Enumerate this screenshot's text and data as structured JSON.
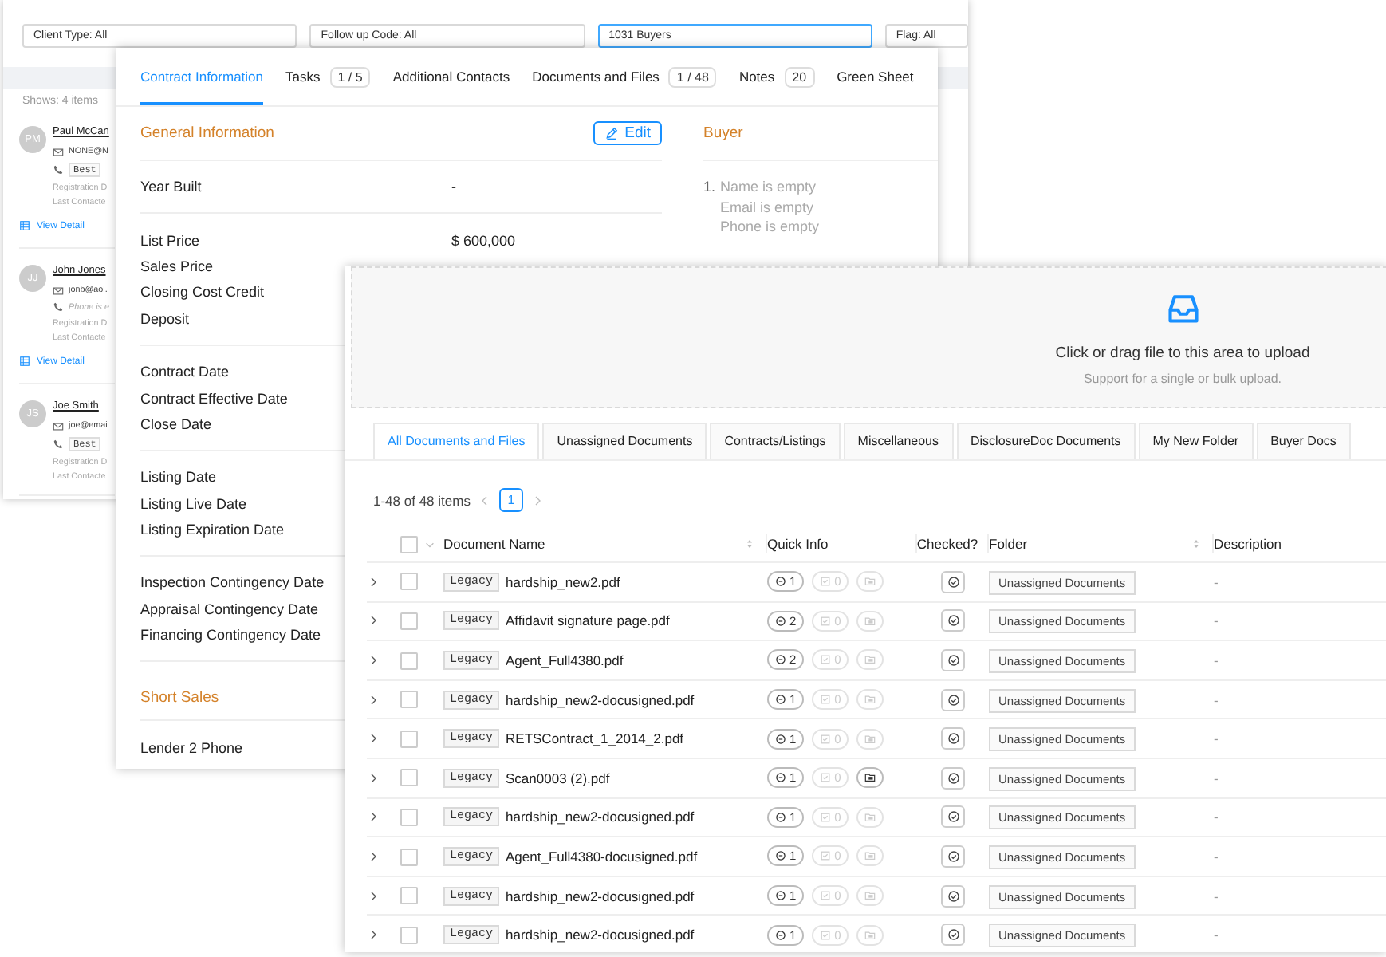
{
  "back_window": {
    "filters": [
      {
        "label": "Client Type: All",
        "focused": false
      },
      {
        "label": "Follow up Code: All",
        "focused": false
      },
      {
        "label": "1031 Buyers",
        "focused": true
      },
      {
        "label": "Flag: All",
        "focused": false
      }
    ],
    "summary": "Shows: 4 items",
    "contacts": [
      {
        "initials": "PM",
        "name": "Paul McCan",
        "email": "NONE@N",
        "phone": {
          "kind": "tagged",
          "tag": "Best"
        },
        "registration": "Registration D",
        "last_contact": "Last Contacte",
        "link": "View Detail"
      },
      {
        "initials": "JJ",
        "name": "John Jones",
        "email": "jonb@aol.",
        "phone": {
          "kind": "empty",
          "text": "Phone is e"
        },
        "registration": "Registration D",
        "last_contact": "Last Contacte",
        "link": "View Detail"
      },
      {
        "initials": "JS",
        "name": "Joe Smith",
        "email": "joe@emai",
        "phone": {
          "kind": "tagged",
          "tag": "Best"
        },
        "registration": "Registration D",
        "last_contact": "Last Contacte"
      }
    ]
  },
  "contract_window": {
    "tabs": [
      {
        "label": "Contract Information",
        "selected": true
      },
      {
        "label": "Tasks",
        "count": "1 / 5",
        "selected": false
      },
      {
        "label": "Additional Contacts",
        "selected": false
      },
      {
        "label": "Documents and Files",
        "count": "1 / 48",
        "selected": false
      },
      {
        "label": "Notes",
        "count": "20",
        "selected": false
      },
      {
        "label": "Green Sheet",
        "selected": false
      }
    ],
    "general": {
      "title": "General Information",
      "edit_label": "Edit",
      "groups": [
        [
          {
            "label": "Year Built",
            "value": "-"
          }
        ],
        [
          {
            "label": "List Price",
            "value": "$ 600,000"
          },
          {
            "label": "Sales Price"
          },
          {
            "label": "Closing Cost Credit"
          },
          {
            "label": "Deposit"
          }
        ],
        [
          {
            "label": "Contract Date"
          },
          {
            "label": "Contract Effective Date"
          },
          {
            "label": "Close Date"
          }
        ],
        [
          {
            "label": "Listing Date"
          },
          {
            "label": "Listing Live Date"
          },
          {
            "label": "Listing Expiration Date"
          }
        ],
        [
          {
            "label": "Inspection Contingency Date"
          },
          {
            "label": "Appraisal Contingency Date"
          },
          {
            "label": "Financing Contingency Date"
          }
        ]
      ]
    },
    "short_sales": {
      "title": "Short Sales",
      "fields": [
        {
          "label": "Lender 2 Phone"
        }
      ]
    },
    "buyer": {
      "title": "Buyer",
      "entries": [
        {
          "number": "1.",
          "lines": [
            "Name is empty",
            "Email is empty",
            "Phone is empty"
          ]
        }
      ]
    }
  },
  "documents_window": {
    "upload": {
      "text": "Click or drag file to this area to upload",
      "hint": "Support for a single or bulk upload."
    },
    "tabs": [
      {
        "label": "All Documents and Files",
        "selected": true
      },
      {
        "label": "Unassigned Documents",
        "selected": false
      },
      {
        "label": "Contracts/Listings",
        "selected": false
      },
      {
        "label": "Miscellaneous",
        "selected": false
      },
      {
        "label": "DisclosureDoc Documents",
        "selected": false
      },
      {
        "label": "My New Folder",
        "selected": false
      },
      {
        "label": "Buyer Docs",
        "selected": false
      }
    ],
    "pagination": {
      "summary": "1-48 of 48 items",
      "pages": [
        {
          "label": "1",
          "selected": true
        }
      ]
    },
    "table": {
      "all_selected": false,
      "columns": [
        {
          "label": "Document Name",
          "sortable": true
        },
        {
          "label": "Quick Info",
          "sortable": false
        },
        {
          "label": "Checked?",
          "sortable": false
        },
        {
          "label": "Folder",
          "sortable": true
        },
        {
          "label": "Description",
          "sortable": false
        }
      ],
      "rows": [
        {
          "selected": false,
          "tag": "Legacy",
          "name": "hardship_new2.pdf",
          "comments": "1",
          "tasks": "0",
          "folder_linked": false,
          "folder": "Unassigned Documents",
          "description": "-"
        },
        {
          "selected": false,
          "tag": "Legacy",
          "name": "Affidavit signature page.pdf",
          "comments": "2",
          "tasks": "0",
          "folder_linked": false,
          "folder": "Unassigned Documents",
          "description": "-"
        },
        {
          "selected": false,
          "tag": "Legacy",
          "name": "Agent_Full4380.pdf",
          "comments": "2",
          "tasks": "0",
          "folder_linked": false,
          "folder": "Unassigned Documents",
          "description": "-"
        },
        {
          "selected": false,
          "tag": "Legacy",
          "name": "hardship_new2-docusigned.pdf",
          "comments": "1",
          "tasks": "0",
          "folder_linked": false,
          "folder": "Unassigned Documents",
          "description": "-"
        },
        {
          "selected": false,
          "tag": "Legacy",
          "name": "RETSContract_1_2014_2.pdf",
          "comments": "1",
          "tasks": "0",
          "folder_linked": false,
          "folder": "Unassigned Documents",
          "description": "-"
        },
        {
          "selected": false,
          "tag": "Legacy",
          "name": "Scan0003 (2).pdf",
          "comments": "1",
          "tasks": "0",
          "folder_linked": true,
          "folder": "Unassigned Documents",
          "description": "-"
        },
        {
          "selected": false,
          "tag": "Legacy",
          "name": "hardship_new2-docusigned.pdf",
          "comments": "1",
          "tasks": "0",
          "folder_linked": false,
          "folder": "Unassigned Documents",
          "description": "-"
        },
        {
          "selected": false,
          "tag": "Legacy",
          "name": "Agent_Full4380-docusigned.pdf",
          "comments": "1",
          "tasks": "0",
          "folder_linked": false,
          "folder": "Unassigned Documents",
          "description": "-"
        },
        {
          "selected": false,
          "tag": "Legacy",
          "name": "hardship_new2-docusigned.pdf",
          "comments": "1",
          "tasks": "0",
          "folder_linked": false,
          "folder": "Unassigned Documents",
          "description": "-"
        },
        {
          "selected": false,
          "tag": "Legacy",
          "name": "hardship_new2-docusigned.pdf",
          "comments": "1",
          "tasks": "0",
          "folder_linked": false,
          "folder": "Unassigned Documents",
          "description": "-"
        }
      ]
    }
  }
}
